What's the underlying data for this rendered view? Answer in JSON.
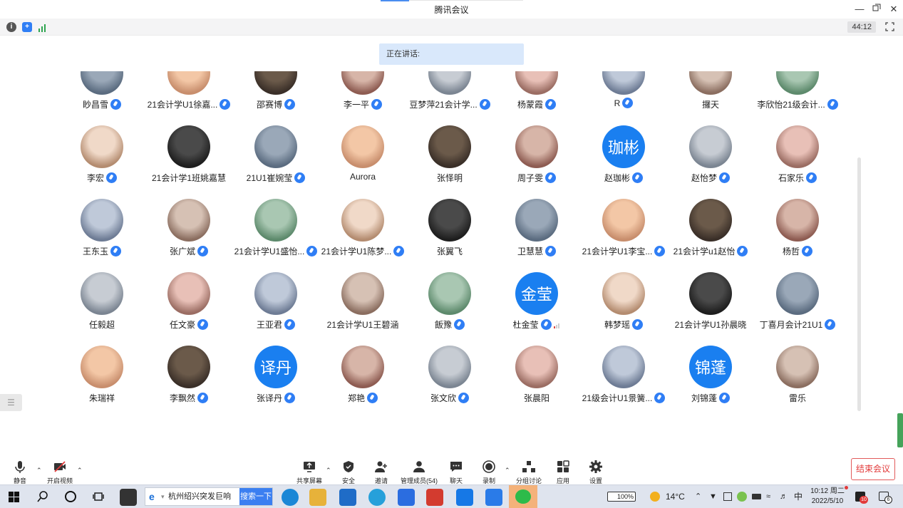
{
  "window": {
    "title": "腾讯会议",
    "controls": [
      "minimize",
      "restore",
      "close"
    ]
  },
  "status": {
    "timer": "44:12",
    "icons": [
      "info-icon",
      "shield-icon",
      "signal-bars-icon"
    ]
  },
  "speaking": {
    "label": "正在讲话:"
  },
  "participants": [
    [
      {
        "name": "眇昌雪",
        "mic": true
      },
      {
        "name": "21会计学U1徐嘉...",
        "mic": true
      },
      {
        "name": "邵赛博",
        "mic": true
      },
      {
        "name": "李一平",
        "mic": true
      },
      {
        "name": "豆梦萍21会计学...",
        "mic": true
      },
      {
        "name": "杨蒙霞",
        "mic": true
      },
      {
        "name": "R",
        "mic": true
      },
      {
        "name": "攞天",
        "mic": false
      },
      {
        "name": "李欣怡21级会计...",
        "mic": true
      }
    ],
    [
      {
        "name": "李宏",
        "mic": true
      },
      {
        "name": "21会计学1班姚嘉慧",
        "mic": false
      },
      {
        "name": "21U1崔婉莹",
        "mic": true
      },
      {
        "name": "Aurora",
        "mic": false
      },
      {
        "name": "张怿明",
        "mic": false
      },
      {
        "name": "周子雯",
        "mic": true
      },
      {
        "name": "赵珈彬",
        "mic": true,
        "avatar_text": "珈彬"
      },
      {
        "name": "赵怡梦",
        "mic": true
      },
      {
        "name": "石家乐",
        "mic": true
      }
    ],
    [
      {
        "name": "王东玉",
        "mic": true
      },
      {
        "name": "张广斌",
        "mic": true
      },
      {
        "name": "21会计学U1盛怡...",
        "mic": true
      },
      {
        "name": "21会计学U1陈梦...",
        "mic": true
      },
      {
        "name": "张翼飞",
        "mic": false
      },
      {
        "name": "卫慧慧",
        "mic": true
      },
      {
        "name": "21会计学U1李宝...",
        "mic": true
      },
      {
        "name": "21会计学u1赵怡",
        "mic": true
      },
      {
        "name": "杨哲",
        "mic": true
      }
    ],
    [
      {
        "name": "任毅超",
        "mic": false
      },
      {
        "name": "任文豪",
        "mic": true
      },
      {
        "name": "王亚君",
        "mic": true
      },
      {
        "name": "21会计学U1王碧涵",
        "mic": false
      },
      {
        "name": "飯豫",
        "mic": true
      },
      {
        "name": "杜金莹",
        "mic": true,
        "avatar_text": "金莹",
        "signal": true
      },
      {
        "name": "韩梦瑶",
        "mic": true
      },
      {
        "name": "21会计学U1孙晨晓",
        "mic": false
      },
      {
        "name": "丁喜月会计21U1",
        "mic": true
      }
    ],
    [
      {
        "name": "朱瑞祥",
        "mic": false
      },
      {
        "name": "李飘然",
        "mic": true
      },
      {
        "name": "张译丹",
        "mic": true,
        "avatar_text": "译丹"
      },
      {
        "name": "郑艳",
        "mic": true
      },
      {
        "name": "张文欣",
        "mic": true
      },
      {
        "name": "张晨阳",
        "mic": false
      },
      {
        "name": "21级会计U1景簧...",
        "mic": true
      },
      {
        "name": "刘锦蓬",
        "mic": true,
        "avatar_text": "锦蓬"
      },
      {
        "name": "雷乐",
        "mic": false
      }
    ]
  ],
  "toolbar": {
    "mute": "静音",
    "video": "开启视频",
    "share": "共享屏幕",
    "security": "安全",
    "invite": "邀请",
    "members": "管理成员(54)",
    "chat": "聊天",
    "record": "录制",
    "breakout": "分组讨论",
    "apps": "应用",
    "settings": "设置",
    "end": "结束会议"
  },
  "taskbar": {
    "search_text": "杭州绍兴突发巨响",
    "search_button": "搜索一下",
    "battery": "100%",
    "temperature": "14°C",
    "ime": "中",
    "time": "10:12 周二",
    "date": "2022/5/10",
    "notification_count": "10",
    "action_center_count": "6"
  },
  "colors": {
    "accent": "#1a7ff0",
    "end_button": "#e23a3a",
    "speaking_bg": "#d9e8fb"
  }
}
